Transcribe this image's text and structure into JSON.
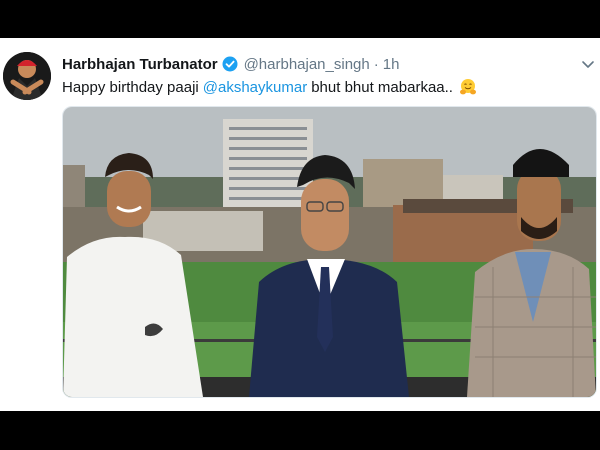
{
  "tweet": {
    "display_name": "Harbhajan Turbanator",
    "handle": "@harbhajan_singh",
    "separator": "·",
    "time": "1h",
    "text_before": "Happy birthday paaji",
    "mention": "@akshaykumar",
    "text_after": "bhut bhut mabarkaa..",
    "verified_icon": "verified-badge-icon",
    "emoji": "hugging-face-emoji"
  },
  "colors": {
    "text": "#14171a",
    "secondary": "#657786",
    "link": "#1b95e0",
    "verified": "#1da1f2"
  },
  "media": {
    "description_icon": "photo"
  }
}
